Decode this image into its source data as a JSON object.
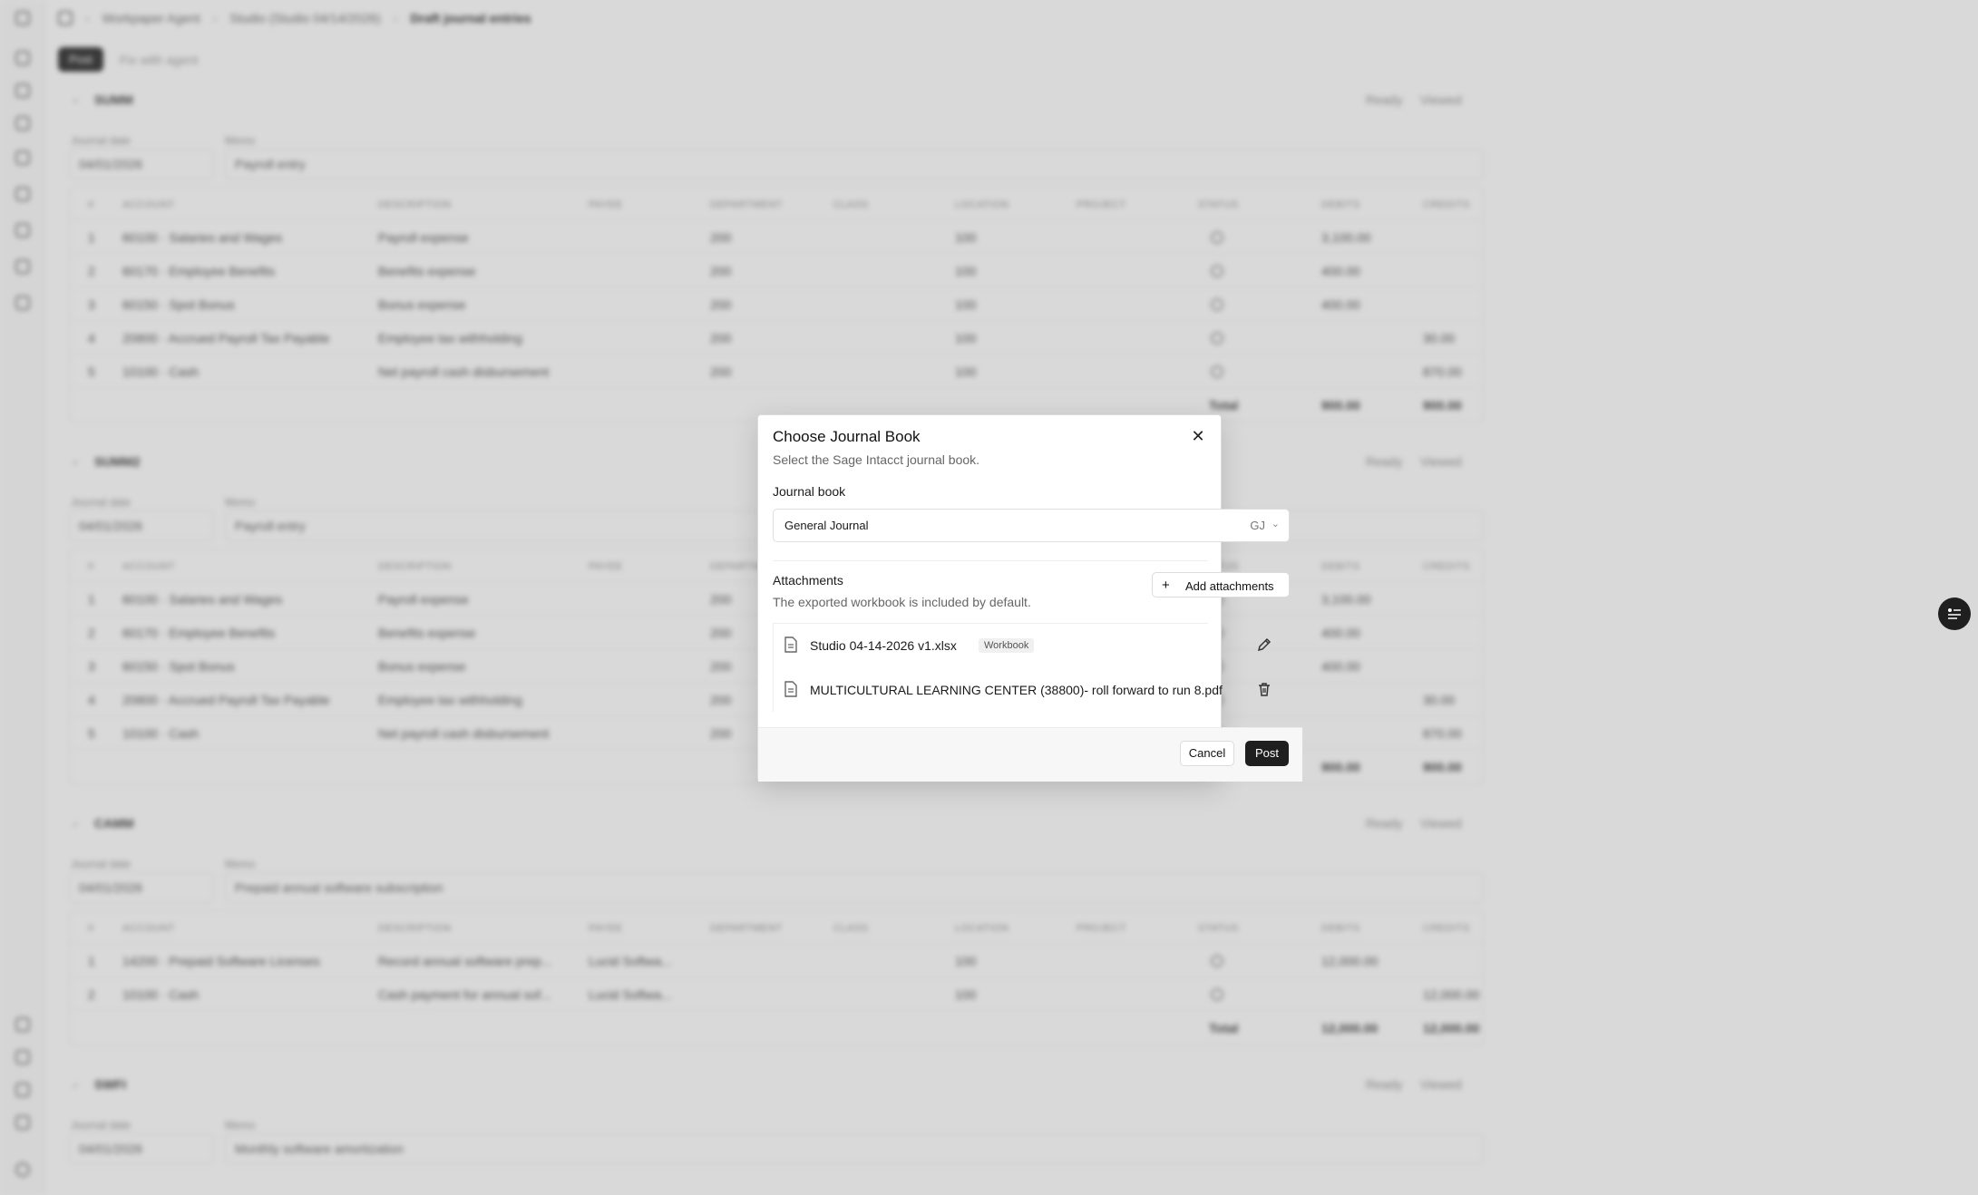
{
  "app": {
    "breadcrumbs": [
      "Workpaper Agent",
      "Studio (Studio 04/14/2026)",
      "Draft journal entries"
    ],
    "toolbar": {
      "primary": "Post",
      "secondary": "Fix with agent"
    }
  },
  "table_headers": [
    "#",
    "ACCOUNT",
    "DESCRIPTION",
    "PAYEE",
    "DEPARTMENT",
    "CLASS",
    "LOCATION",
    "PROJECT",
    "STATUS",
    "DEBITS",
    "CREDITS"
  ],
  "entries": [
    {
      "id": "SUMM",
      "status1": "Ready",
      "status2": "Viewed",
      "date_label": "Journal date",
      "date": "04/01/2026",
      "memo_label": "Memo",
      "memo": "Payroll entry",
      "rows": [
        [
          "1",
          "60100 · Salaries and Wages",
          "Payroll expense",
          "",
          "200",
          "",
          "100",
          "",
          "",
          "3,100.00",
          ""
        ],
        [
          "2",
          "60170 · Employee Benefits",
          "Benefits expense",
          "",
          "200",
          "",
          "100",
          "",
          "",
          "400.00",
          ""
        ],
        [
          "3",
          "60150 · Spot Bonus",
          "Bonus expense",
          "",
          "200",
          "",
          "100",
          "",
          "",
          "400.00",
          ""
        ],
        [
          "4",
          "20800 · Accrued Payroll Tax Payable",
          "Employee tax withholding",
          "",
          "200",
          "",
          "100",
          "",
          "",
          "",
          "30.00"
        ],
        [
          "5",
          "10100 · Cash",
          "Net payroll cash disbursement",
          "",
          "200",
          "",
          "100",
          "",
          "",
          "",
          "870.00"
        ]
      ],
      "total_label": "Total",
      "total_debit": "900.00",
      "total_credit": "900.00"
    },
    {
      "id": "SUMM2",
      "status1": "Ready",
      "status2": "Viewed",
      "date_label": "Journal date",
      "date": "04/01/2026",
      "memo_label": "Memo",
      "memo": "Payroll entry",
      "rows": [
        [
          "1",
          "60100 · Salaries and Wages",
          "Payroll expense",
          "",
          "200",
          "",
          "100",
          "",
          "",
          "3,100.00",
          ""
        ],
        [
          "2",
          "60170 · Employee Benefits",
          "Benefits expense",
          "",
          "200",
          "",
          "100",
          "",
          "",
          "400.00",
          ""
        ],
        [
          "3",
          "60150 · Spot Bonus",
          "Bonus expense",
          "",
          "200",
          "",
          "100",
          "",
          "",
          "400.00",
          ""
        ],
        [
          "4",
          "20800 · Accrued Payroll Tax Payable",
          "Employee tax withholding",
          "",
          "200",
          "",
          "100",
          "",
          "",
          "",
          "30.00"
        ],
        [
          "5",
          "10100 · Cash",
          "Net payroll cash disbursement",
          "",
          "200",
          "",
          "100",
          "",
          "",
          "",
          "870.00"
        ]
      ],
      "total_label": "Total",
      "total_debit": "900.00",
      "total_credit": "900.00"
    },
    {
      "id": "CAMM",
      "status1": "Ready",
      "status2": "Viewed",
      "date_label": "Journal date",
      "date": "04/01/2026",
      "memo_label": "Memo",
      "memo": "Prepaid annual software subscription",
      "rows": [
        [
          "1",
          "14200 · Prepaid Software Licenses",
          "Record annual software prep...",
          "Lucid Softwa...",
          "",
          "",
          "100",
          "",
          "",
          "12,000.00",
          ""
        ],
        [
          "2",
          "10100 · Cash",
          "Cash payment for annual sof...",
          "Lucid Softwa...",
          "",
          "",
          "100",
          "",
          "",
          "",
          "12,000.00"
        ]
      ],
      "total_label": "Total",
      "total_debit": "12,000.00",
      "total_credit": "12,000.00"
    },
    {
      "id": "SWFI",
      "status1": "Ready",
      "status2": "Viewed",
      "date_label": "Journal date",
      "date": "04/01/2026",
      "memo_label": "Memo",
      "memo": "Monthly software amortization",
      "rows": [],
      "total_label": "",
      "total_debit": "",
      "total_credit": ""
    }
  ],
  "dialog": {
    "title": "Choose Journal Book",
    "subtitle": "Select the Sage Intacct journal book.",
    "journal_label": "Journal book",
    "journal_value": "General Journal",
    "journal_code": "GJ",
    "attachments_label": "Attachments",
    "attachments_subtitle": "The exported workbook is included by default.",
    "add_label": "Add attachments",
    "files": [
      {
        "name": "Studio 04-14-2026 v1.xlsx",
        "badge": "Workbook",
        "action": "edit"
      },
      {
        "name": "MULTICULTURAL LEARNING CENTER (38800)- roll forward to run 8.pdf",
        "badge": "",
        "action": "delete"
      }
    ],
    "cancel_label": "Cancel",
    "post_label": "Post"
  },
  "icons": {
    "close": "close-icon",
    "chevron": "chevron-down-icon",
    "plus": "plus-icon",
    "file": "file-icon",
    "edit": "pencil-icon",
    "delete": "trash-icon",
    "fab": "list-icon"
  }
}
